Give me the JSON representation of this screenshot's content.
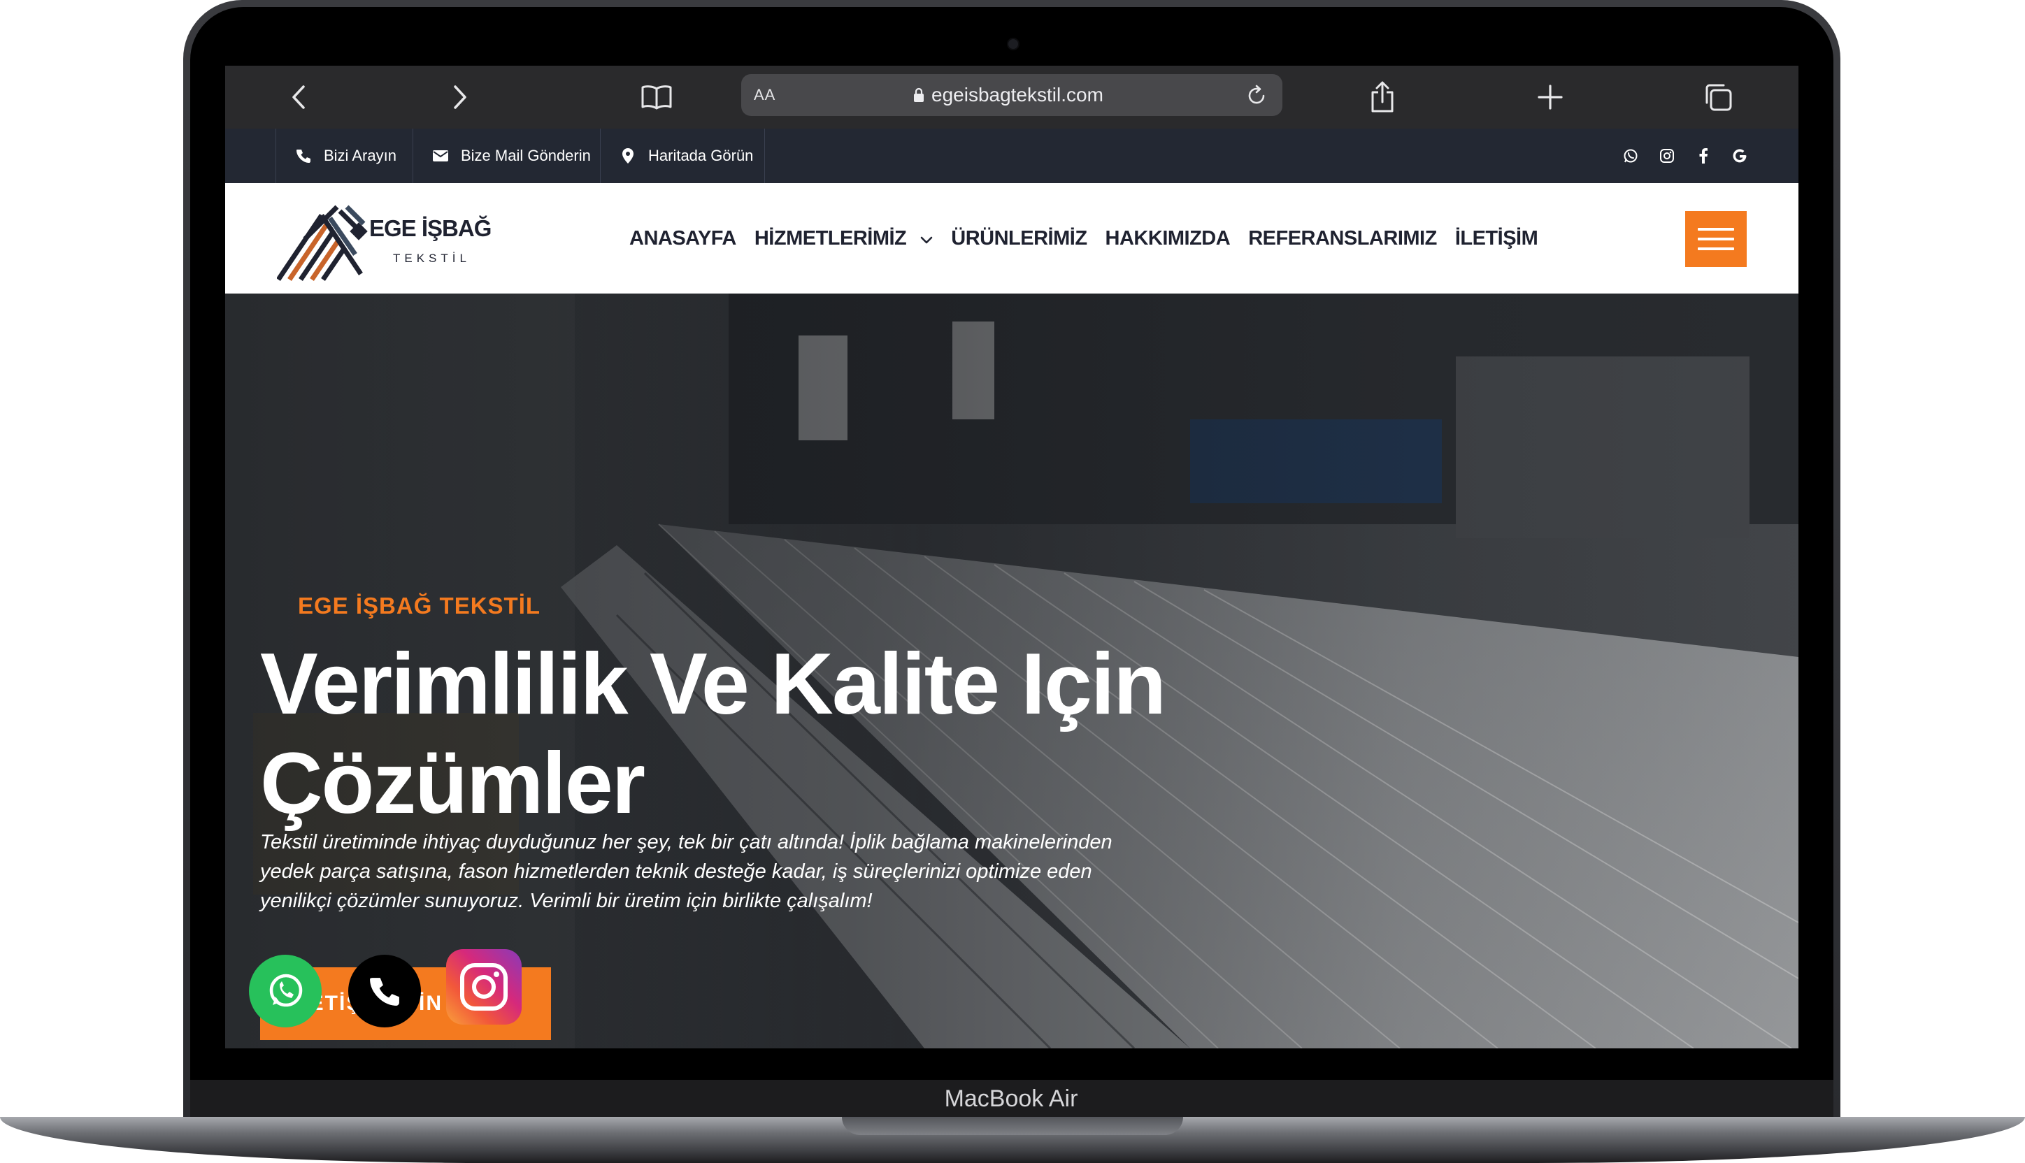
{
  "device": {
    "model_label": "MacBook Air"
  },
  "browser": {
    "reader_label": "AA",
    "url": "egeisbagtekstil.com",
    "icons": [
      "back-icon",
      "forward-icon",
      "bookmarks-icon",
      "lock-icon",
      "reload-icon",
      "share-icon",
      "new-tab-icon",
      "tabs-icon"
    ]
  },
  "topbar": {
    "call": "Bizi Arayın",
    "mail": "Bize Mail Gönderin",
    "map": "Haritada Görün",
    "social_icons": [
      "whatsapp-icon",
      "instagram-icon",
      "facebook-icon",
      "google-icon"
    ]
  },
  "header": {
    "logo_name": "EGE İŞBAĞ",
    "logo_sub": "TEKSTİL",
    "nav": {
      "home": "ANASAYFA",
      "services": "HİZMETLERİMİZ",
      "products": "ÜRÜNLERİMİZ",
      "about": "HAKKIMIZDA",
      "references": "REFERANSLARIMIZ",
      "contact": "İLETİŞİM"
    }
  },
  "hero": {
    "kicker": "EGE İŞBAĞ TEKSTİL",
    "title": "Verimlilik Ve Kalite Için Çözümler",
    "description": "Tekstil üretiminde ihtiyaç duyduğunuz her şey, tek bir çatı altında! İplik bağlama makinelerinden yedek parça satışına, fason hizmetlerden teknik desteğe kadar, iş süreçlerinizi optimize eden yenilikçi çözümler sunuyoruz. Verimli bir üretim için birlikte çalışalım!",
    "cta": "İLETİŞİM İÇİN"
  },
  "floating": [
    "whatsapp-icon",
    "phone-icon",
    "instagram-icon"
  ],
  "colors": {
    "accent": "#f47a1f",
    "topbar": "#232833",
    "text_dark": "#1f2230",
    "whatsapp": "#27c15b"
  }
}
